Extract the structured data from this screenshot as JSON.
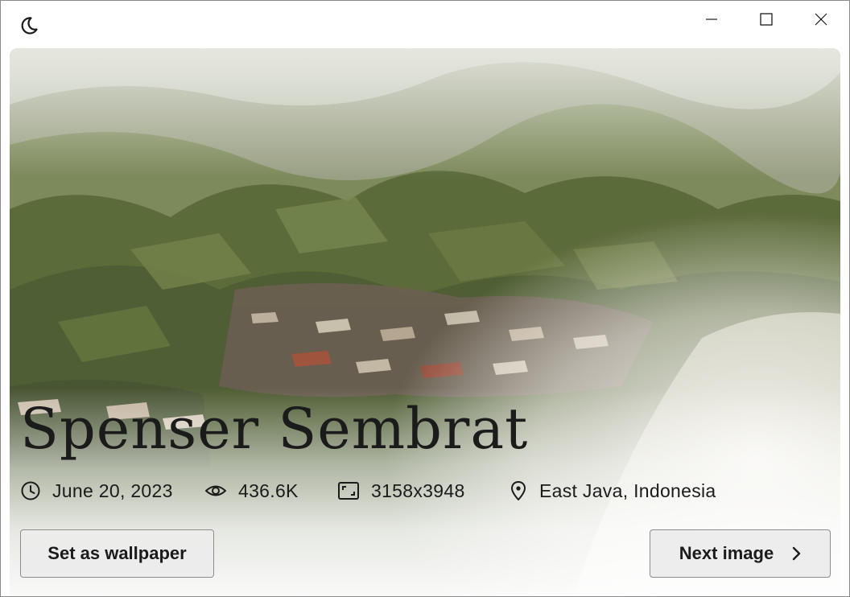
{
  "window": {
    "controls": {
      "theme_icon": "moon-icon",
      "minimize_icon": "minimize-icon",
      "maximize_icon": "maximize-icon",
      "close_icon": "close-icon"
    }
  },
  "hero": {
    "photo_description_icon": "landscape-photo",
    "photographer": "Spenser Sembrat",
    "meta": {
      "date": {
        "icon": "clock-icon",
        "text": "June 20, 2023"
      },
      "views": {
        "icon": "eye-icon",
        "text": "436.6K"
      },
      "resolution": {
        "icon": "aspect-ratio-icon",
        "text": "3158x3948"
      },
      "location": {
        "icon": "location-pin-icon",
        "text": "East Java, Indonesia"
      }
    }
  },
  "actions": {
    "set_wallpaper_label": "Set as wallpaper",
    "next_image_label": "Next image",
    "next_icon": "chevron-right-icon"
  },
  "colors": {
    "text": "#1b1b1b",
    "button_bg": "#ebebeb",
    "button_border": "#8d8d8d",
    "mist": "#ffffff",
    "foliage": "#4f5e35"
  }
}
